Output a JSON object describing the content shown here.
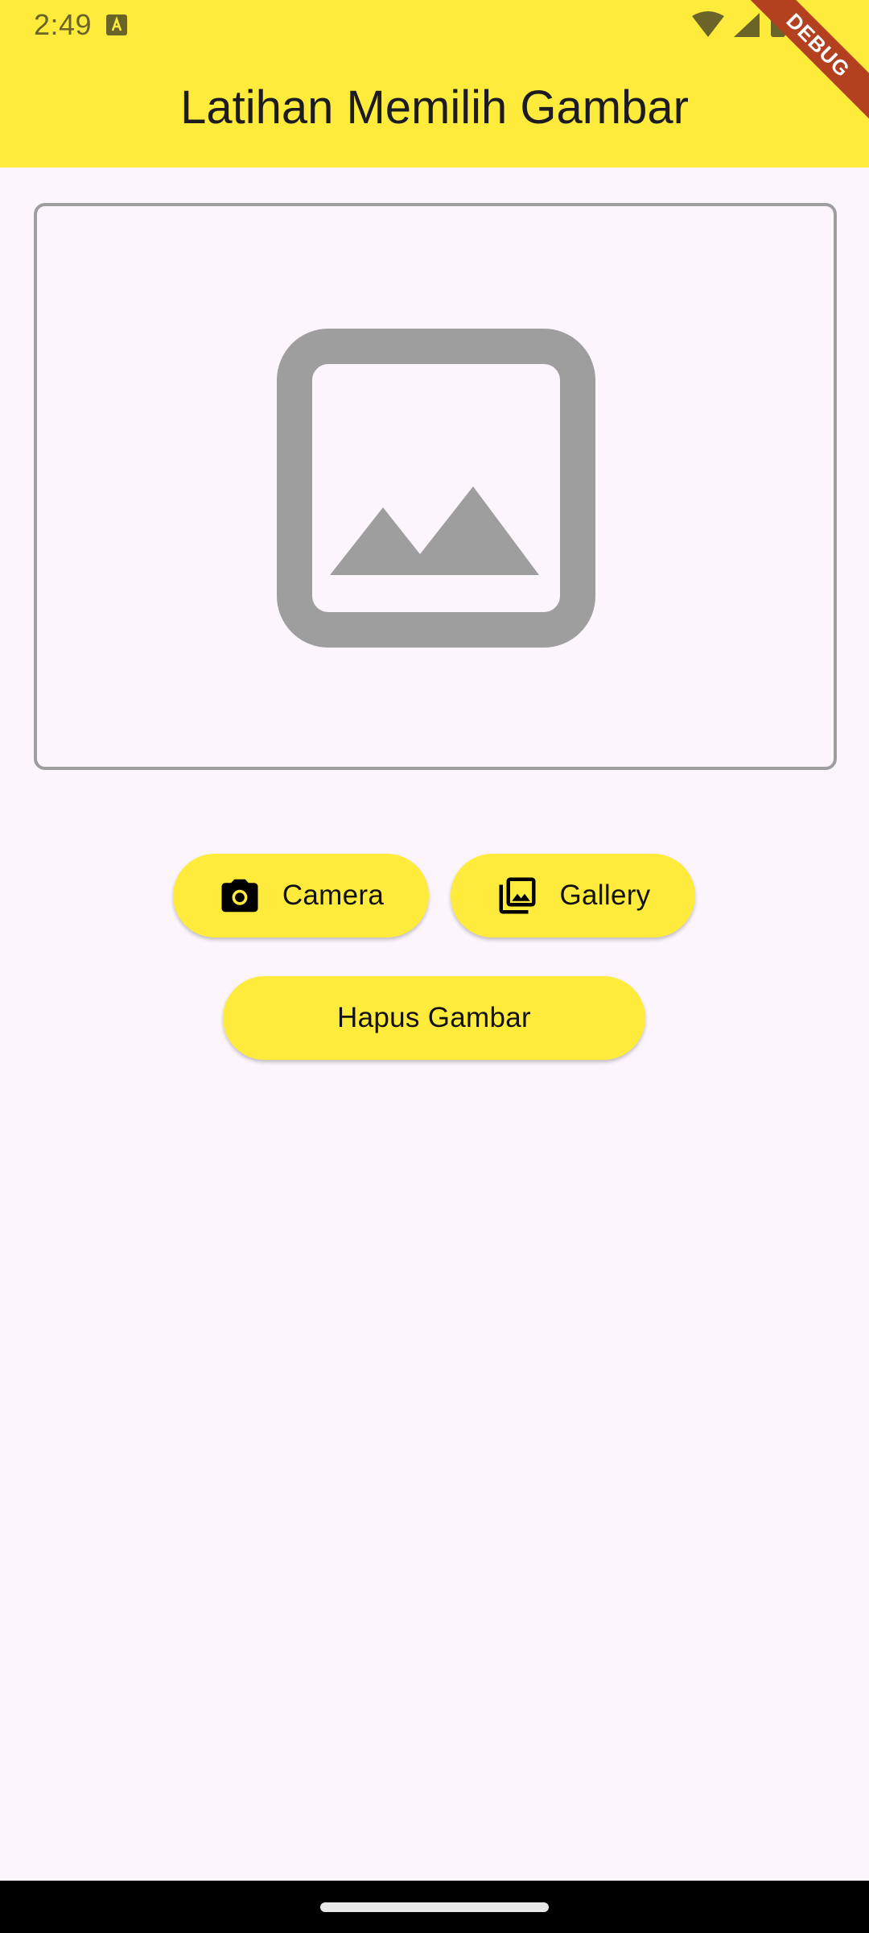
{
  "status_bar": {
    "time": "2:49"
  },
  "app_bar": {
    "title": "Latihan Memilih Gambar"
  },
  "debug_banner": {
    "label": "DEBUG"
  },
  "preview": {
    "icon": "image-placeholder-icon"
  },
  "buttons": {
    "camera": {
      "label": "Camera",
      "icon": "camera-icon"
    },
    "gallery": {
      "label": "Gallery",
      "icon": "photo-library-icon"
    },
    "hapus": {
      "label": "Hapus Gambar"
    }
  },
  "colors": {
    "primary": "#FFEB3B",
    "background": "#FCF5FC",
    "placeholder_gray": "#9E9E9E",
    "debug_ribbon": "#B3401E"
  }
}
